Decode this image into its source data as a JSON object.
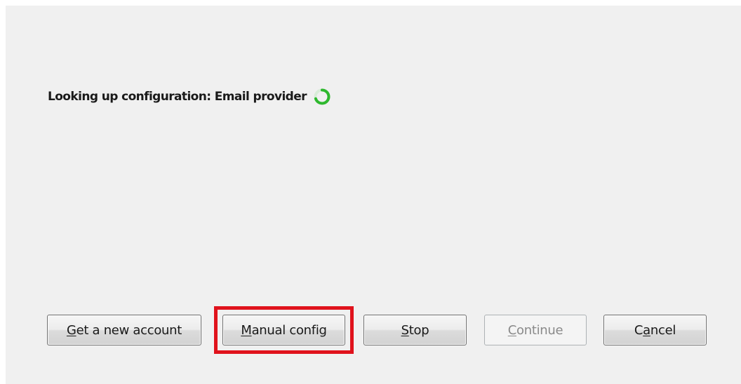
{
  "status": {
    "text": "Looking up configuration: Email provider",
    "icon": "spinner-icon"
  },
  "buttons": {
    "get_new_account": {
      "accel": "G",
      "rest": "et a new account",
      "enabled": true
    },
    "manual_config": {
      "accel": "M",
      "rest": "anual config",
      "enabled": true,
      "highlighted": true
    },
    "stop": {
      "accel": "S",
      "rest": "top",
      "enabled": true
    },
    "continue": {
      "accel": "C",
      "rest": "ontinue",
      "enabled": false
    },
    "cancel": {
      "pre": "C",
      "accel": "a",
      "rest": "ncel",
      "enabled": true
    }
  },
  "colors": {
    "panel_background": "#f0f0f0",
    "spinner": "#2eb82e",
    "highlight_box": "#e0121c"
  }
}
